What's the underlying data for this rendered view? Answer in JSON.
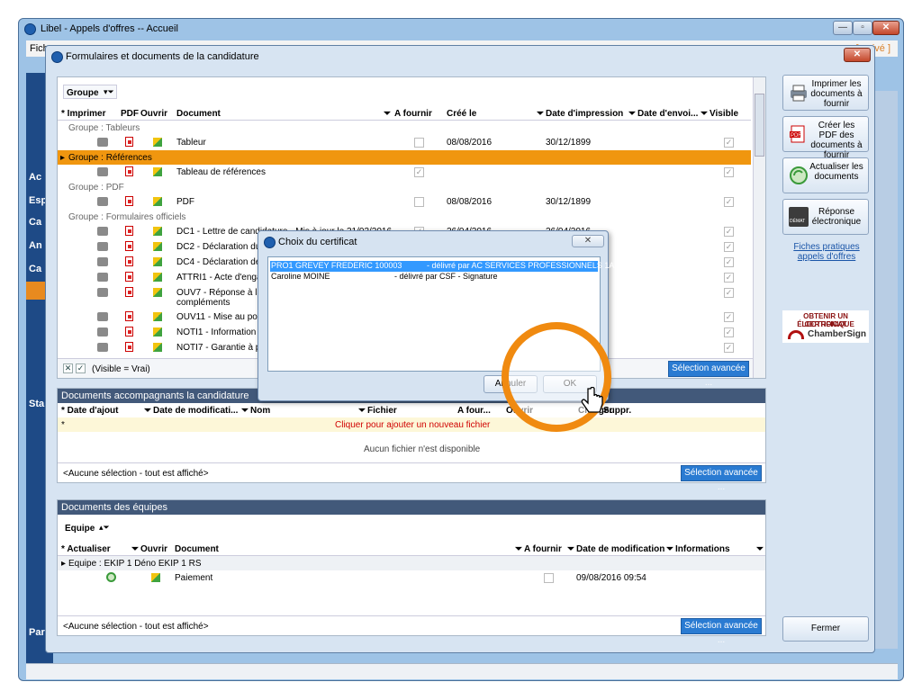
{
  "outer": {
    "title": "Libel - Appels d'offres -- Accueil",
    "menu_start": "Fich",
    "right_text": "[ ... ivé ]",
    "sidebar": [
      "Ac",
      "Esp",
      "Ca",
      "An",
      "Ca",
      "Sta",
      "Par"
    ],
    "min": "—",
    "max": "▫",
    "close": "✕"
  },
  "dialog": {
    "title": "Formulaires et documents de la candidature",
    "close": "✕",
    "docs": {
      "group_label": "Groupe",
      "columns": [
        "Imprimer",
        "PDF",
        "Ouvrir",
        "Document",
        "A fournir",
        "Créé le",
        "Date d'impression",
        "Date d'envoi...",
        "Visible"
      ],
      "rows": [
        {
          "kind": "group",
          "text": "Groupe : Tableurs"
        },
        {
          "kind": "doc",
          "doc": "Tableur",
          "afournir": false,
          "cree": "08/08/2016",
          "impression": "30/12/1899",
          "envoi": "",
          "visible": true
        },
        {
          "kind": "group",
          "text": "Groupe : Références",
          "selected": true
        },
        {
          "kind": "doc",
          "doc": "Tableau de références",
          "afournir": true,
          "cree": "",
          "impression": "",
          "envoi": "",
          "visible": true
        },
        {
          "kind": "group",
          "text": "Groupe : PDF"
        },
        {
          "kind": "doc",
          "doc": "PDF",
          "afournir": false,
          "cree": "08/08/2016",
          "impression": "30/12/1899",
          "envoi": "",
          "visible": true
        },
        {
          "kind": "group",
          "text": "Groupe : Formulaires officiels"
        },
        {
          "kind": "doc",
          "doc": "DC1 - Lettre de candidature - Mis à jour le 31/03/2016",
          "afournir": true,
          "cree": "26/04/2016",
          "impression": "26/04/2016",
          "envoi": "",
          "visible": true
        },
        {
          "kind": "doc",
          "doc": "DC2 - Déclaration du ca",
          "afournir": false,
          "cree": "",
          "impression": "",
          "envoi": "",
          "visible": true
        },
        {
          "kind": "doc",
          "doc": "DC4 - Déclaration de so",
          "afournir": false,
          "cree": "",
          "impression": "",
          "envoi": "",
          "visible": true
        },
        {
          "kind": "doc",
          "doc": "ATTRI1 - Acte d'engag",
          "afournir": false,
          "cree": "",
          "impression": "",
          "envoi": "",
          "visible": true
        },
        {
          "kind": "doc2",
          "doc": "OUV7 - Réponse à la de",
          "doc2": "compléments",
          "afournir": false,
          "cree": "",
          "impression": "",
          "envoi": "",
          "visible": true
        },
        {
          "kind": "doc",
          "doc": "OUV11 - Mise au point",
          "afournir": false,
          "cree": "",
          "impression": "",
          "envoi": "",
          "visible": true
        },
        {
          "kind": "doc",
          "doc": "NOTI1 - Information au",
          "afournir": false,
          "cree": "",
          "impression": "",
          "envoi": "",
          "visible": true
        },
        {
          "kind": "doc",
          "doc": "NOTI7 - Garantie à pre",
          "afournir": false,
          "cree": "",
          "impression": "",
          "envoi": "",
          "visible": true
        },
        {
          "kind": "doc",
          "doc": "NOTI8 - Caution perso",
          "afournir": false,
          "cree": "",
          "impression": "",
          "envoi": "",
          "visible": true
        }
      ],
      "filter": "(Visible = Vrai)",
      "adv": "Sélection avancée ..."
    },
    "acc": {
      "title": "Documents accompagnants la candidature",
      "columns": [
        "Date d'ajout",
        "Date de modificati...",
        "Nom",
        "Fichier",
        "A four...",
        "Ouvrir",
        "Charger",
        "Suppr."
      ],
      "add_hint": "Cliquer pour ajouter un nouveau fichier",
      "empty": "Aucun fichier n'est disponible",
      "footer": "<Aucune sélection - tout est affiché>",
      "adv": "Sélection avancée ..."
    },
    "teams": {
      "title": "Documents des équipes",
      "group_label": "Equipe",
      "columns": [
        "Actualiser",
        "Ouvrir",
        "Document",
        "A fournir",
        "Date de modification",
        "Informations"
      ],
      "group_row": "Equipe : EKIP 1 Déno EKIP 1 RS",
      "row": {
        "doc": "Paiement",
        "date": "09/08/2016 09:54"
      },
      "footer": "<Aucune sélection - tout est affiché>",
      "adv": "Sélection avancée ..."
    },
    "right": {
      "print": "Imprimer les documents à fournir",
      "pdf": "Créer les PDF des documents à fournir",
      "refresh": "Actualiser les documents",
      "reponse": "Réponse électronique",
      "demat": "DÉMAT",
      "link": "Fiches pratiques appels d'offres",
      "chambersign": {
        "line1": "OBTENIR UN CERTIFICAT",
        "line2": "ÉLECTRONIQUE",
        "brand": "ChamberSign"
      },
      "close": "Fermer"
    }
  },
  "cert": {
    "title": "Choix du certificat",
    "close": "✕",
    "items": [
      {
        "name": "PRO1 GREVEY FREDERIC 100003",
        "issuer": "- délivré par AC SERVICES PROFESSIONNELS 1A",
        "selected": true
      },
      {
        "name": "Caroline MOINE",
        "issuer": "- délivré par CSF - Signature",
        "selected": false
      }
    ],
    "cancel": "Annuler",
    "ok": "OK"
  },
  "colors": {
    "selected_row": "#f0960f",
    "accent": "#2a7bd2",
    "ring": "#f08a10"
  }
}
